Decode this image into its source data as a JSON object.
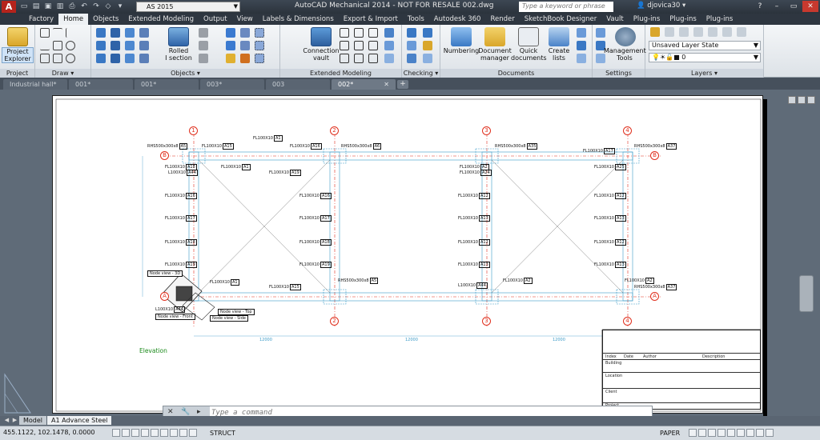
{
  "titlebar": {
    "logo": "A",
    "workspace": "AS 2015",
    "title": "AutoCAD Mechanical 2014 - NOT FOR RESALE     002.dwg",
    "search_placeholder": "Type a keyword or phrase",
    "user": "djovica30"
  },
  "ribbon_tabs": [
    "Factory",
    "Home",
    "Objects",
    "Extended Modeling",
    "Output",
    "View",
    "Labels & Dimensions",
    "Export & Import",
    "Tools",
    "Autodesk 360",
    "Render",
    "SketchBook Designer",
    "Vault",
    "Plug-ins",
    "Plug-ins",
    "Plug-ins"
  ],
  "active_ribbon_tab": "Home",
  "ribbon": {
    "project": {
      "title": "Project",
      "button": "Project\nExplorer"
    },
    "draw": {
      "title": "Draw"
    },
    "objects": {
      "title": "Objects",
      "big_button": "Rolled\nI section"
    },
    "extended_modeling": {
      "title": "Extended Modeling",
      "big_button": "Connection\nvault"
    },
    "checking": {
      "title": "Checking"
    },
    "documents": {
      "title": "Documents",
      "buttons": [
        "Numbering",
        "Document\nmanager",
        "Quick\ndocuments",
        "Create\nlists"
      ]
    },
    "settings": {
      "title": "Settings",
      "button": "Management\nTools"
    },
    "layers": {
      "title": "Layers",
      "layer_state": "Unsaved Layer State",
      "layer": "0"
    }
  },
  "doc_tabs": [
    "Industrial hall*",
    "001*",
    "001*",
    "003*",
    "003",
    "002*"
  ],
  "active_doc_tab": "002*",
  "drawing": {
    "elevation_label": "Elevation",
    "grid_numbers": [
      "1",
      "2",
      "3",
      "4"
    ],
    "grid_letters": [
      "A",
      "B"
    ],
    "node_views": [
      "Node view - 3D",
      "Node view - Top",
      "Node view - Front",
      "Node view - Side"
    ],
    "beam_top": "RHS500x300x8",
    "dimension_labels": [
      "12000",
      "12000",
      "12000"
    ],
    "member_labels": [
      {
        "text": "FL100X10",
        "tag": "A1"
      },
      {
        "text": "FL100X10",
        "tag": "A15"
      },
      {
        "text": "FL100X10",
        "tag": "A16"
      },
      {
        "text": "FL100X10",
        "tag": "A17"
      },
      {
        "text": "FL100X10",
        "tag": "A18"
      },
      {
        "text": "FL100X10",
        "tag": "A19"
      },
      {
        "text": "L100X10",
        "tag": "A44"
      },
      {
        "text": "FL100X10",
        "tag": "A24"
      },
      {
        "text": "FL100X10",
        "tag": "A12"
      },
      {
        "text": "FL100X10",
        "tag": "A13"
      },
      {
        "text": "FL100X10",
        "tag": "A2"
      },
      {
        "text": "FL100X10",
        "tag": "A25"
      },
      {
        "text": "RHS500x300x8",
        "tag": "A5"
      },
      {
        "text": "RHS500x300x8",
        "tag": "A6"
      },
      {
        "text": "RHS500x300x8",
        "tag": "A35"
      },
      {
        "text": "RHS500x300x8",
        "tag": "A37"
      }
    ],
    "titleblock": {
      "headers": [
        "Index",
        "Date",
        "Author",
        "Description"
      ],
      "rows": [
        "Building",
        "Location",
        "Client",
        "Project"
      ]
    }
  },
  "command": {
    "placeholder": "Type a command"
  },
  "layout_tabs": [
    "Model",
    "A1 Advance Steel"
  ],
  "active_layout_tab": "A1 Advance Steel",
  "status": {
    "coords": "455.1122, 102.1478, 0.0000",
    "struct": "STRUCT",
    "paper": "PAPER"
  },
  "colors": {
    "grid": "#e0301e",
    "elevation": "#1a8a1a",
    "node": "#4aa0c8"
  }
}
